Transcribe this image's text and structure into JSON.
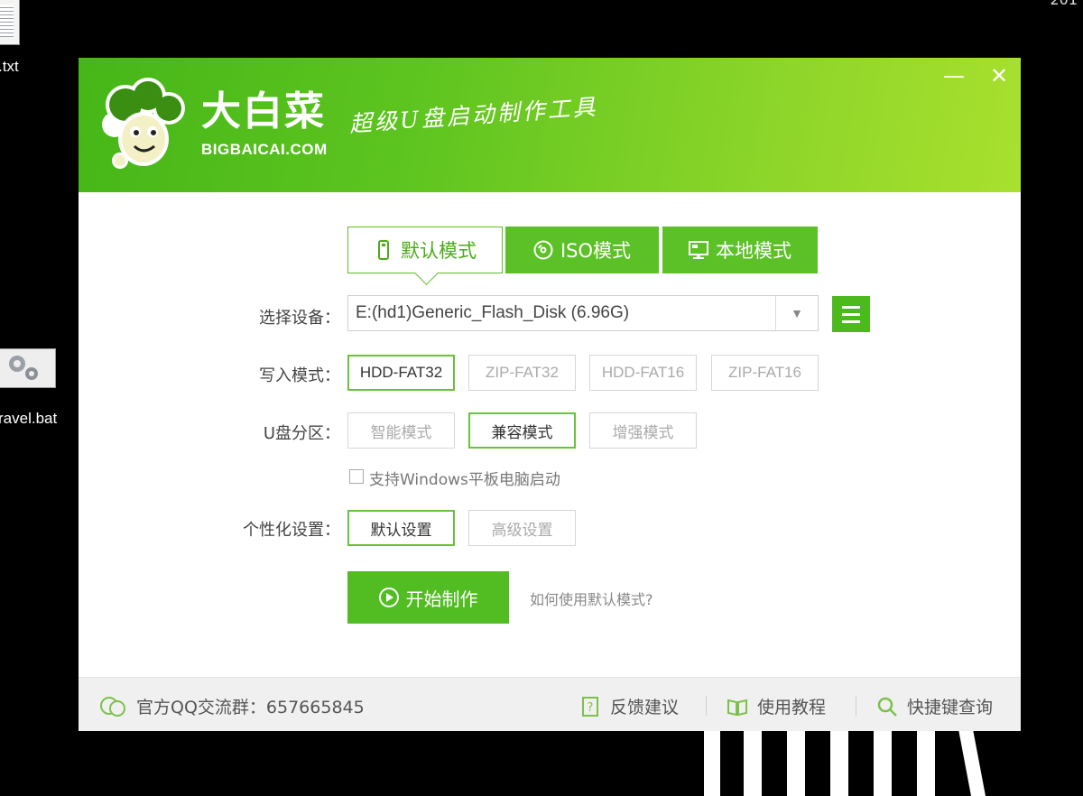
{
  "desktop": {
    "file1_label": ".txt",
    "file2_label": "ravel.bat",
    "corner_text": "201"
  },
  "window": {
    "brand_title": "大白菜",
    "brand_domain": "BIGBAICAI.COM",
    "slogan": "超级U盘启动制作工具",
    "minimize_label": "—",
    "close_label": "✕"
  },
  "tabs": [
    {
      "label": "默认模式",
      "icon": "usb-icon",
      "active": true
    },
    {
      "label": "ISO模式",
      "icon": "disc-icon",
      "active": false
    },
    {
      "label": "本地模式",
      "icon": "monitor-icon",
      "active": false
    }
  ],
  "device": {
    "label": "选择设备：",
    "value": "E:(hd1)Generic_Flash_Disk (6.96G)"
  },
  "write_mode": {
    "label": "写入模式：",
    "options": [
      "HDD-FAT32",
      "ZIP-FAT32",
      "HDD-FAT16",
      "ZIP-FAT16"
    ],
    "selected": "HDD-FAT32"
  },
  "partition": {
    "label": "U盘分区：",
    "options": [
      "智能模式",
      "兼容模式",
      "增强模式"
    ],
    "selected": "兼容模式"
  },
  "tablet": {
    "label": "支持Windows平板电脑启动",
    "checked": false
  },
  "personalize": {
    "label": "个性化设置：",
    "options": [
      "默认设置",
      "高级设置"
    ],
    "selected": "默认设置"
  },
  "start_button": "开始制作",
  "help_link": "如何使用默认模式?",
  "footer": {
    "qq_group": "官方QQ交流群：657665845",
    "feedback": "反馈建议",
    "tutorial": "使用教程",
    "shortcut": "快捷键查询"
  },
  "colors": {
    "brand_green": "#5cc127",
    "header_gradient_end": "#a9e02e"
  }
}
